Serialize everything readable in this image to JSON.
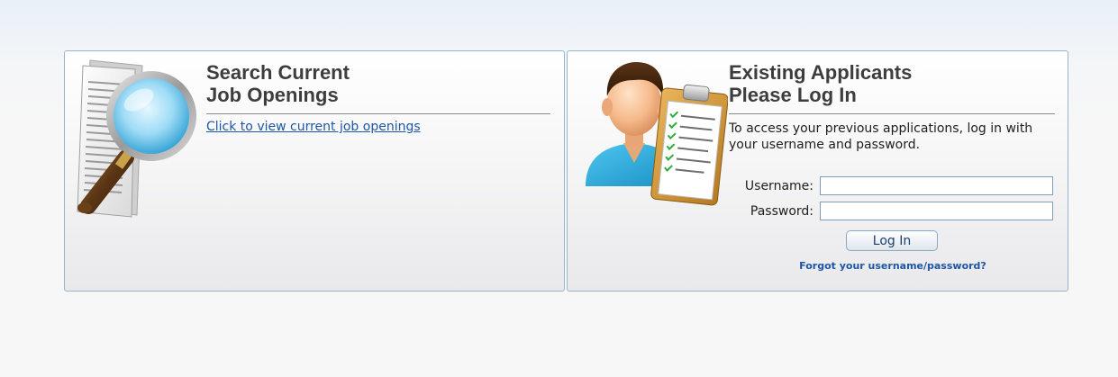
{
  "search_panel": {
    "heading_line1": "Search Current",
    "heading_line2": "Job Openings",
    "link_text": "Click to view current job openings",
    "illustration": "magnifying-glass-document-icon"
  },
  "login_panel": {
    "heading_line1": "Existing Applicants",
    "heading_line2": "Please Log In",
    "intro": "To access your previous applications, log in with your username and password.",
    "username_label": "Username:",
    "username_value": "",
    "password_label": "Password:",
    "password_value": "",
    "login_button": "Log In",
    "forgot_link": "Forgot your username/password?",
    "illustration": "person-with-clipboard-icon"
  },
  "colors": {
    "link": "#1d56a6",
    "panel_border": "#98b4cc",
    "heading": "#3d3d3d"
  }
}
